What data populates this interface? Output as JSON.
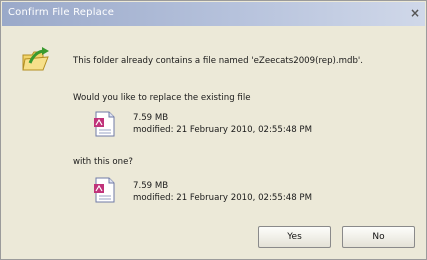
{
  "dialog": {
    "title": "Confirm File Replace",
    "close_glyph": "×",
    "message": "This folder already contains a file named 'eZeecats2009(rep).mdb'.",
    "question": "Would you like to replace the existing file",
    "with_label": "with this one?",
    "existing_file": {
      "size": "7.59 MB",
      "modified": "modified: 21 February 2010, 02:55:48 PM",
      "icon": "file-icon"
    },
    "new_file": {
      "size": "7.59 MB",
      "modified": "modified: 21 February 2010, 02:55:48 PM",
      "icon": "file-icon"
    },
    "buttons": {
      "yes": "Yes",
      "no": "No"
    },
    "folder_icon": "folder-arrow-icon"
  }
}
